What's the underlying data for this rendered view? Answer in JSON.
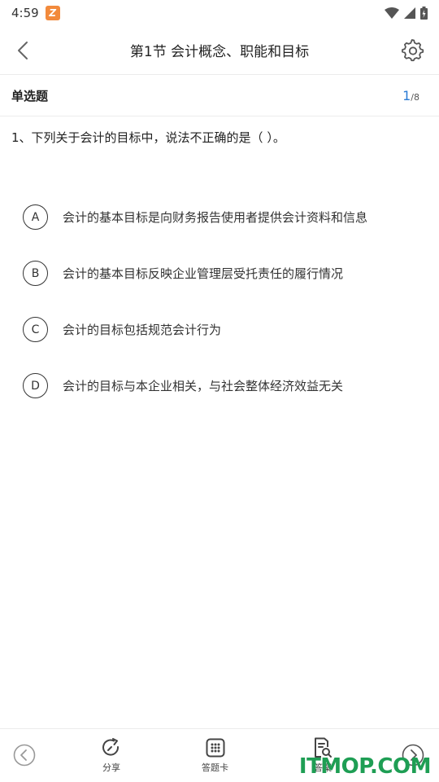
{
  "status_bar": {
    "time": "4:59",
    "notification_icon": "app-logo-icon"
  },
  "header": {
    "title": "第1节 会计概念、职能和目标"
  },
  "question_bar": {
    "type": "单选题",
    "current": "1",
    "separator": "/",
    "total": "8"
  },
  "question": {
    "text": "1、下列关于会计的目标中，说法不正确的是（   ）。"
  },
  "options": [
    {
      "letter": "A",
      "text": "会计的基本目标是向财务报告使用者提供会计资料和信息"
    },
    {
      "letter": "B",
      "text": "会计的基本目标反映企业管理层受托责任的履行情况"
    },
    {
      "letter": "C",
      "text": "会计的目标包括规范会计行为"
    },
    {
      "letter": "D",
      "text": "会计的目标与本企业相关，与社会整体经济效益无关"
    }
  ],
  "bottom_bar": {
    "share_label": "分享",
    "answer_card_label": "答题卡",
    "answer_label": "答案"
  },
  "watermark": "ITMOP.COM",
  "colors": {
    "accent": "#2a7bd5",
    "notif_bg": "#f28a3c",
    "watermark": "#1e9e54"
  }
}
